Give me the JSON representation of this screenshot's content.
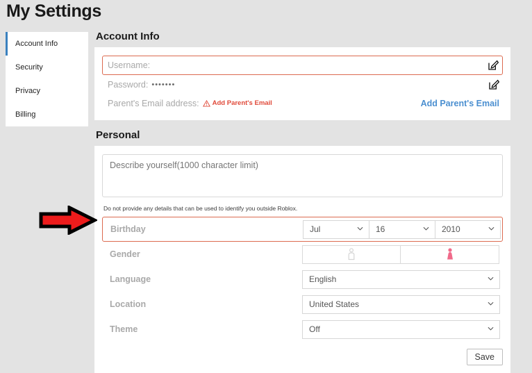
{
  "page": {
    "title": "My Settings",
    "background_color": "#e3e3e3"
  },
  "sidebar": {
    "items": [
      {
        "label": "Account Info",
        "active": true
      },
      {
        "label": "Security",
        "active": false
      },
      {
        "label": "Privacy",
        "active": false
      },
      {
        "label": "Billing",
        "active": false
      }
    ],
    "active_accent_color": "#3a81bf"
  },
  "account_info": {
    "title": "Account Info",
    "username_row": {
      "label": "Username:",
      "value": "",
      "edit_icon": "edit-pencil-icon",
      "highlighted": true,
      "highlight_color": "#dc6a4f"
    },
    "password_row": {
      "label": "Password:",
      "masked_value": "•••••••",
      "edit_icon": "edit-pencil-icon"
    },
    "parent_email_row": {
      "label": "Parent's Email address:",
      "warning_icon": "warning-triangle-icon",
      "warning_text": "Add Parent's Email",
      "warning_color": "#e04a3a",
      "action_label": "Add Parent's Email",
      "action_color": "#4b8fd0"
    }
  },
  "personal": {
    "title": "Personal",
    "describe": {
      "placeholder": "Describe yourself(1000 character limit)",
      "value": ""
    },
    "hint": "Do not provide any details that can be used to identify you outside Roblox.",
    "birthday": {
      "label": "Birthday",
      "highlighted": true,
      "highlight_color": "#dc6a4f",
      "month": "Jul",
      "day": "16",
      "year": "2010"
    },
    "gender": {
      "label": "Gender",
      "options": [
        {
          "icon": "male-person-icon",
          "selected": false,
          "color": "#d5d5d5"
        },
        {
          "icon": "female-person-icon",
          "selected": true,
          "color": "#f06a8a"
        }
      ]
    },
    "language": {
      "label": "Language",
      "value": "English"
    },
    "location": {
      "label": "Location",
      "value": "United States"
    },
    "theme": {
      "label": "Theme",
      "value": "Off"
    },
    "save_label": "Save"
  },
  "annotation": {
    "arrow": {
      "icon": "red-right-arrow-icon",
      "fill_color": "#ee1c1c",
      "stroke_color": "#000000",
      "points_to": "birthday-row"
    }
  }
}
